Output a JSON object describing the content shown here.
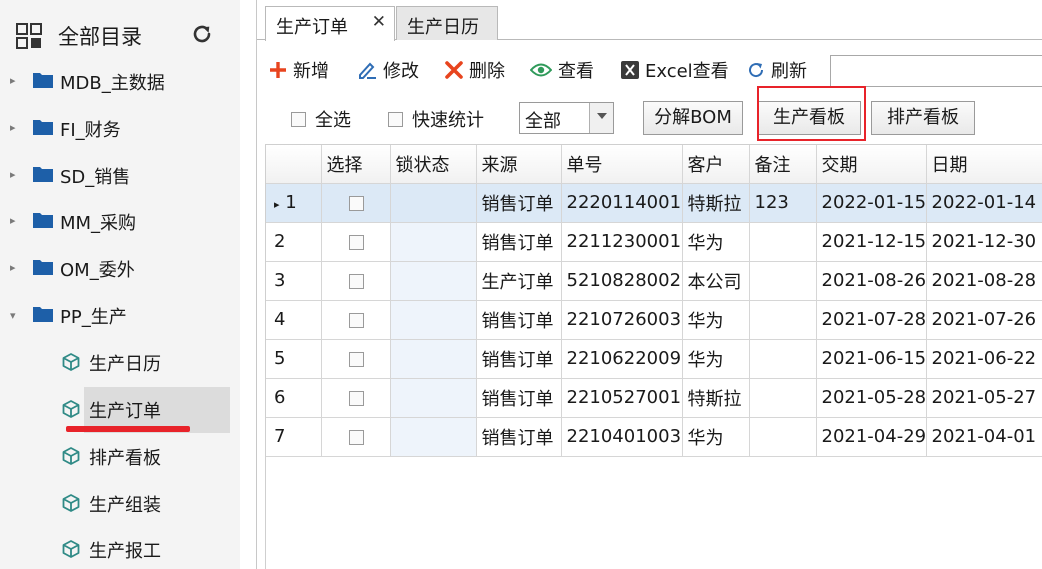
{
  "sidebar": {
    "title": "全部目录",
    "groups": [
      {
        "label": "MDB_主数据",
        "expanded": false
      },
      {
        "label": "FI_财务",
        "expanded": false
      },
      {
        "label": "SD_销售",
        "expanded": false
      },
      {
        "label": "MM_采购",
        "expanded": false
      },
      {
        "label": "OM_委外",
        "expanded": false
      },
      {
        "label": "PP_生产",
        "expanded": true
      }
    ],
    "pp_children": [
      {
        "label": "生产日历"
      },
      {
        "label": "生产订单",
        "active": true
      },
      {
        "label": "排产看板"
      },
      {
        "label": "生产组装"
      },
      {
        "label": "生产报工"
      }
    ]
  },
  "tabs": [
    {
      "label": "生产订单",
      "active": true
    },
    {
      "label": "生产日历",
      "active": false
    }
  ],
  "toolbar": {
    "add": "新增",
    "edit": "修改",
    "delete": "删除",
    "view": "查看",
    "excel": "Excel查看",
    "refresh": "刷新"
  },
  "filters": {
    "select_all": "全选",
    "quick_stats": "快速统计",
    "combo_value": "全部",
    "btn_bom": "分解BOM",
    "btn_kanban": "生产看板",
    "btn_schedule": "排产看板"
  },
  "grid": {
    "columns": [
      "",
      "选择",
      "锁状态",
      "来源",
      "单号",
      "客户",
      "备注",
      "交期",
      "日期"
    ],
    "rows": [
      {
        "n": "1",
        "source": "销售订单",
        "no": "2220114001",
        "customer": "特斯拉",
        "note": "123",
        "due": "2022-01-15",
        "date": "2022-01-14"
      },
      {
        "n": "2",
        "source": "销售订单",
        "no": "2211230001",
        "customer": "华为",
        "note": "",
        "due": "2021-12-15",
        "date": "2021-12-30"
      },
      {
        "n": "3",
        "source": "生产订单",
        "no": "5210828002",
        "customer": "本公司",
        "note": "",
        "due": "2021-08-26",
        "date": "2021-08-28"
      },
      {
        "n": "4",
        "source": "销售订单",
        "no": "2210726003",
        "customer": "华为",
        "note": "",
        "due": "2021-07-28",
        "date": "2021-07-26"
      },
      {
        "n": "5",
        "source": "销售订单",
        "no": "2210622009",
        "customer": "华为",
        "note": "",
        "due": "2021-06-15",
        "date": "2021-06-22"
      },
      {
        "n": "6",
        "source": "销售订单",
        "no": "2210527001",
        "customer": "特斯拉",
        "note": "",
        "due": "2021-05-28",
        "date": "2021-05-27"
      },
      {
        "n": "7",
        "source": "销售订单",
        "no": "2210401003",
        "customer": "华为",
        "note": "",
        "due": "2021-04-29",
        "date": "2021-04-01"
      }
    ]
  },
  "colors": {
    "accent_red": "#e8232a",
    "folder_blue": "#1d5fa8",
    "cube_teal": "#2f8a86",
    "selected_row": "#dce9f6"
  }
}
